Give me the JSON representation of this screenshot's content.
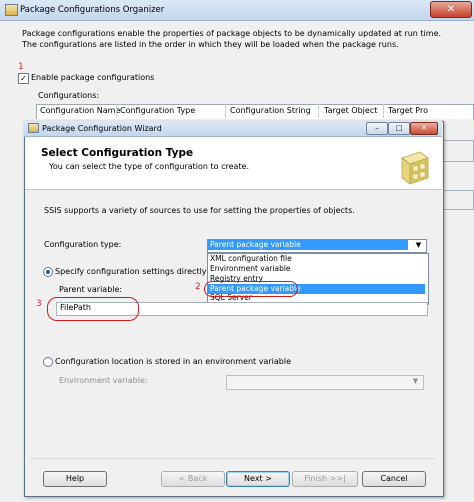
{
  "outer": {
    "title": "Package Configurations Organizer",
    "description": "Package configurations enable the properties of package objects to be dynamically updated at run time. The configurations are listed in the order in which they will be loaded when the package runs.",
    "enable_label": "Enable package configurations",
    "enable_checked": true,
    "configs_label": "Configurations:",
    "columns": [
      "Configuration Name",
      "Configuration Type",
      "Configuration String",
      "Target Object",
      "Target Pro"
    ]
  },
  "annotations": {
    "n1": "1",
    "n2": "2",
    "n3": "3"
  },
  "wizard": {
    "title": "Package Configuration Wizard",
    "title_buttons": {
      "minimize": "–",
      "maximize": "□",
      "close": "✕"
    },
    "heading": "Select Configuration Type",
    "subheading": "You can select the type of configuration to create.",
    "intro": "SSIS supports a variety of sources to use for setting the properties of objects.",
    "config_type_label": "Configuration type:",
    "config_type_value": "Parent package variable",
    "dropdown_options": [
      "XML configuration file",
      "Environment variable",
      "Registry entry",
      "Parent package variable",
      "SQL Server"
    ],
    "option1_label": "Specify configuration settings directly",
    "parent_label": "Parent variable:",
    "parent_value": "FilePath",
    "option2_label": "Configuration location is stored in an environment variable",
    "env_label": "Environment variable:",
    "buttons": {
      "help": "Help",
      "back": "< Back",
      "next": "Next >",
      "finish": "Finish >>|",
      "cancel": "Cancel"
    }
  },
  "colors": {
    "annotation": "#d11b1b",
    "selection": "#3399ff"
  }
}
